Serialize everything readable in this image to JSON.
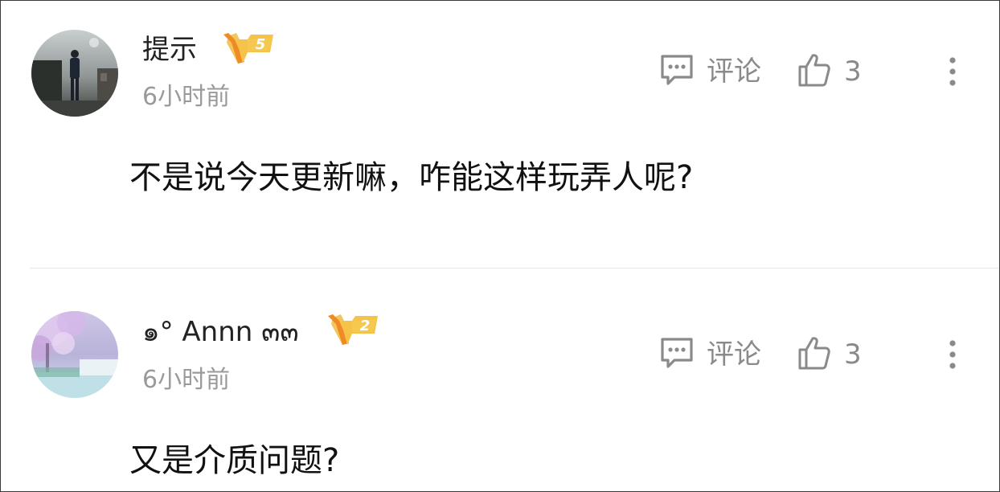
{
  "comments": [
    {
      "username": "提示",
      "vip_level": "5",
      "time": "6小时前",
      "comment_label": "评论",
      "like_count": "3",
      "text": "不是说今天更新嘛，咋能这样玩弄人呢?"
    },
    {
      "username": "๑° Annn ๓๓",
      "vip_level": "2",
      "time": "6小时前",
      "comment_label": "评论",
      "like_count": "3",
      "text": "又是介质问题?"
    }
  ],
  "colors": {
    "username": "#222222",
    "meta_gray": "#9a9a9a",
    "action_gray": "#8a8a8a",
    "badge_gold": "#f0b43c",
    "badge_orange": "#f08a24",
    "divider": "#e6e6e6"
  },
  "icons": {
    "comment": "speech-bubble-icon",
    "like": "thumbs-up-icon",
    "more": "vertical-ellipsis-icon",
    "badge": "fox-v-badge-icon"
  }
}
